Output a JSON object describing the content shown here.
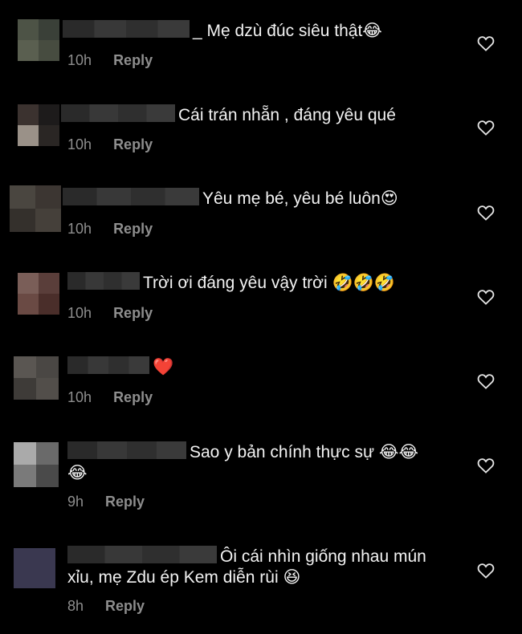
{
  "comments": [
    {
      "text": "_ Mẹ dzù đúc siêu thật😂",
      "time": "10h",
      "reply": "Reply"
    },
    {
      "text": "Cái trán nhẵn , đáng yêu qué",
      "time": "10h",
      "reply": "Reply"
    },
    {
      "text": "Yêu mẹ bé, yêu bé luôn😍",
      "time": "10h",
      "reply": "Reply"
    },
    {
      "text": "Trời ơi đáng yêu vậy trời 🤣🤣🤣",
      "time": "10h",
      "reply": "Reply"
    },
    {
      "text": "❤️",
      "time": "10h",
      "reply": "Reply"
    },
    {
      "text_line1": "Sao y bản chính thực sự 😂😂",
      "text_line2": "😂",
      "time": "9h",
      "reply": "Reply"
    },
    {
      "text_line1": "Ôi cái nhìn giống nhau mún",
      "text_line2": "xỉu, mẹ Zdu ép Kem diễn rùi 😆",
      "time": "8h",
      "reply": "Reply"
    }
  ],
  "icons": {
    "like": "heart-outline-icon"
  },
  "colors": {
    "background": "#000000",
    "meta": "#8e8e8e",
    "text": "#f2f2f2"
  }
}
